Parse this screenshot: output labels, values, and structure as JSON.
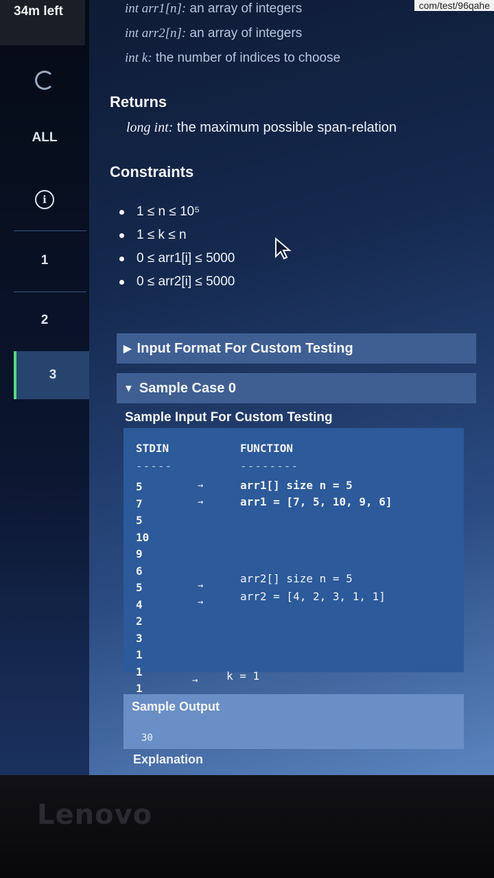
{
  "timer": "34m left",
  "url_fragment": "com/test/96qahe",
  "rail": {
    "all_label": "ALL",
    "info_icon_glyph": "i",
    "questions": [
      "1",
      "2",
      "3"
    ],
    "active_question": "3"
  },
  "params": [
    {
      "type": "int arr1[n]:",
      "desc": " an array of integers"
    },
    {
      "type": "int arr2[n]:",
      "desc": " an array of integers"
    },
    {
      "type": "int k:",
      "desc": " the number of indices to choose"
    }
  ],
  "returns": {
    "heading": "Returns",
    "type": "long int:",
    "desc": " the maximum possible span-relation"
  },
  "constraints": {
    "heading": "Constraints",
    "items": [
      "1 ≤ n ≤ 10⁵",
      "1 ≤ k ≤ n",
      "0 ≤ arr1[i] ≤ 5000",
      "0 ≤ arr2[i] ≤ 5000"
    ]
  },
  "input_format_label": "Input Format For Custom Testing",
  "sample_case_label": "Sample Case 0",
  "sample_input_heading": "Sample Input For Custom Testing",
  "code": {
    "stdin_header": "STDIN",
    "function_header": "FUNCTION",
    "stdin_dash": "-----",
    "function_dash": "--------",
    "stdin_values": [
      "5",
      "7",
      "5",
      "10",
      "9",
      "6",
      "5",
      "4",
      "2",
      "3",
      "1",
      "1",
      "1"
    ],
    "function_lines": [
      "arr1[] size n = 5",
      "arr1 = [7, 5, 10, 9, 6]",
      "arr2[] size n = 5",
      "arr2 = [4, 2, 3, 1, 1]",
      "k = 1"
    ],
    "arrow": "→"
  },
  "sample_output": {
    "heading": "Sample Output",
    "value": "30"
  },
  "explanation_heading": "Explanation",
  "brand": "Lenovo"
}
